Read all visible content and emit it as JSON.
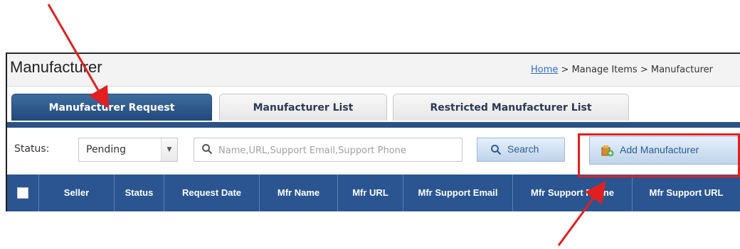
{
  "window": {
    "title": "Manufacturer"
  },
  "breadcrumb": {
    "home": "Home",
    "sep1": " > ",
    "manage": "Manage Items",
    "sep2": " > ",
    "current": "Manufacturer"
  },
  "tabs": [
    {
      "label": "Manufacturer Request",
      "active": true
    },
    {
      "label": "Manufacturer List",
      "active": false
    },
    {
      "label": "Restricted Manufacturer List",
      "active": false
    }
  ],
  "filter": {
    "status_label": "Status:",
    "status_value": "Pending",
    "search_placeholder": "Name,URL,Support Email,Support Phone",
    "search_button": "Search",
    "add_button": "Add Manufacturer"
  },
  "table": {
    "columns": [
      "Seller",
      "Status",
      "Request Date",
      "Mfr Name",
      "Mfr URL",
      "Mfr Support Email",
      "Mfr Support Phone",
      "Mfr Support URL"
    ]
  },
  "colors": {
    "tab_active": "#2b5285",
    "header_bg": "#2a5590",
    "highlight": "#e02020",
    "link": "#2f6fbf"
  },
  "icons": {
    "search": "magnifier-icon",
    "add": "add-manufacturer-icon",
    "dropdown": "triangle-down-icon"
  }
}
